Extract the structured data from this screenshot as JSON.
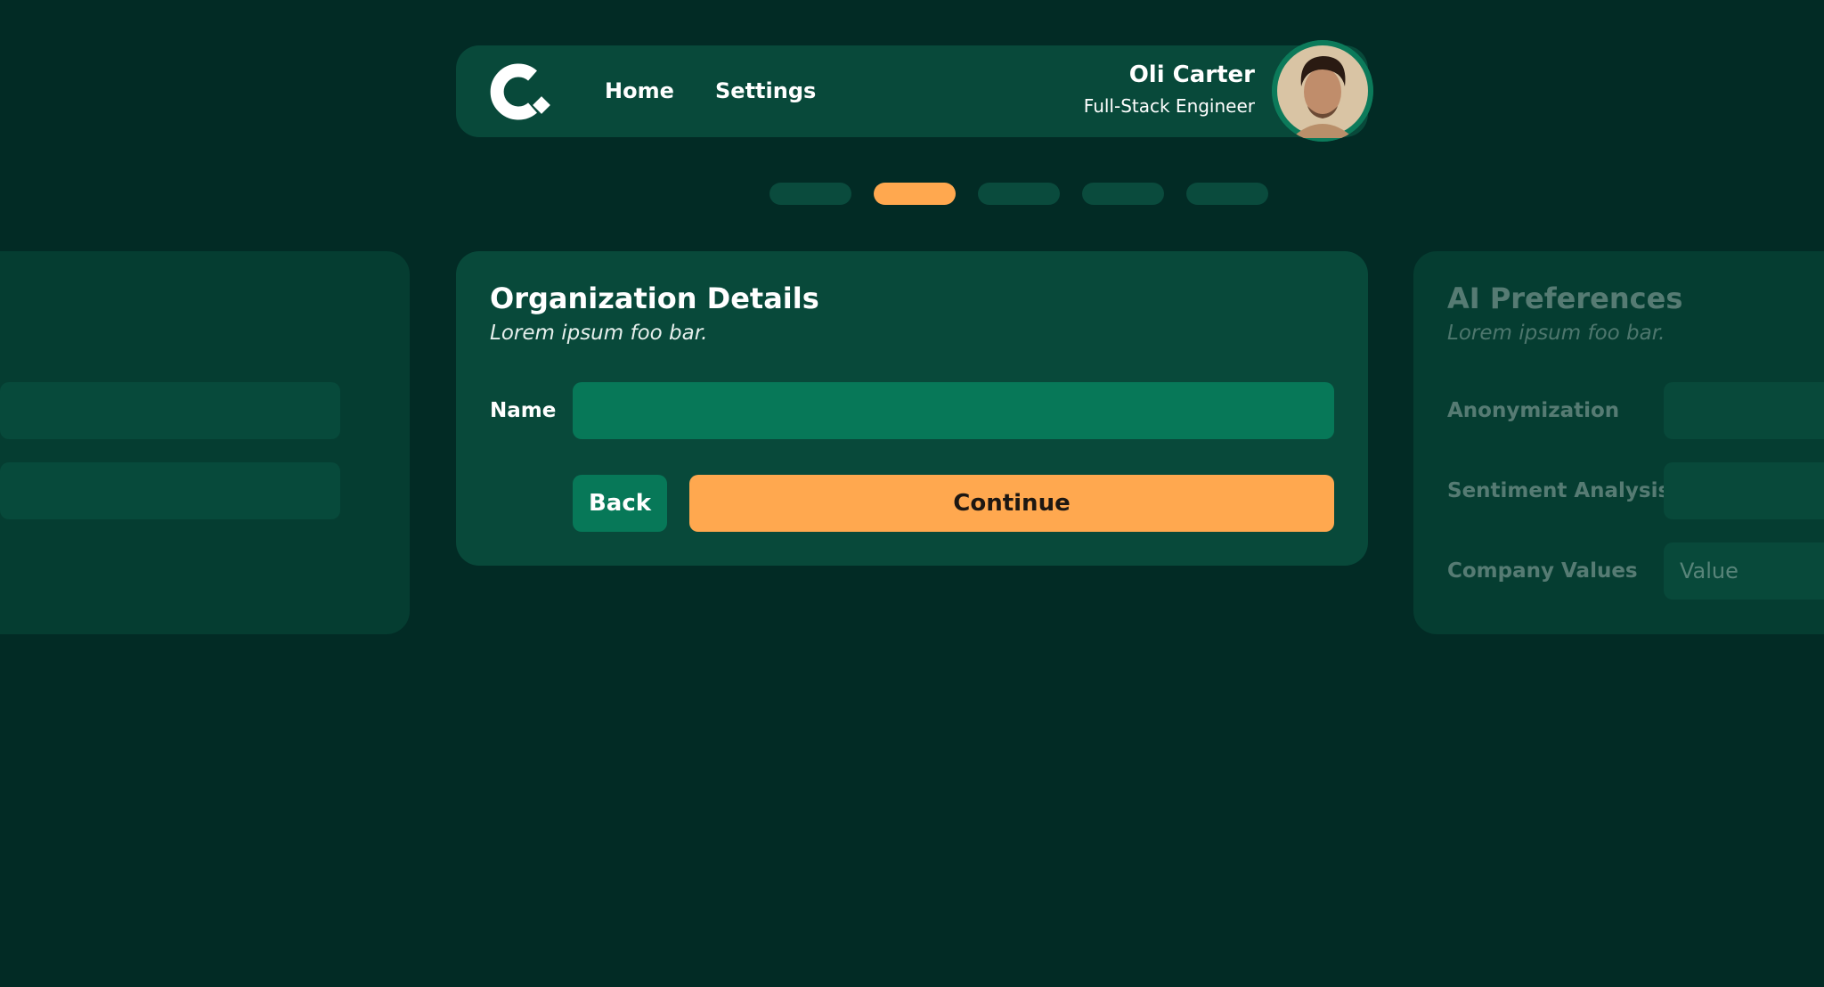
{
  "colors": {
    "background": "#022b25",
    "card": "#08493a",
    "input": "#077858",
    "accent": "#ffa84f"
  },
  "header": {
    "logo_icon": "brand-c-logo",
    "nav": [
      {
        "label": "Home"
      },
      {
        "label": "Settings"
      }
    ],
    "user": {
      "name": "Oli Carter",
      "role": "Full-Stack Engineer",
      "avatar_icon": "user-avatar-photo"
    }
  },
  "progress": {
    "total_steps": 5,
    "current_step": 2
  },
  "main_card": {
    "title": "Organization Details",
    "subtitle": "Lorem ipsum foo bar.",
    "fields": [
      {
        "label": "Name",
        "value": "",
        "placeholder": ""
      }
    ],
    "back_label": "Back",
    "continue_label": "Continue"
  },
  "next_card": {
    "title": "AI Preferences",
    "subtitle": "Lorem ipsum foo bar.",
    "fields": [
      {
        "label": "Anonymization",
        "placeholder": ""
      },
      {
        "label": "Sentiment Analysis",
        "placeholder": ""
      },
      {
        "label": "Company Values",
        "placeholder": "Value"
      }
    ]
  }
}
